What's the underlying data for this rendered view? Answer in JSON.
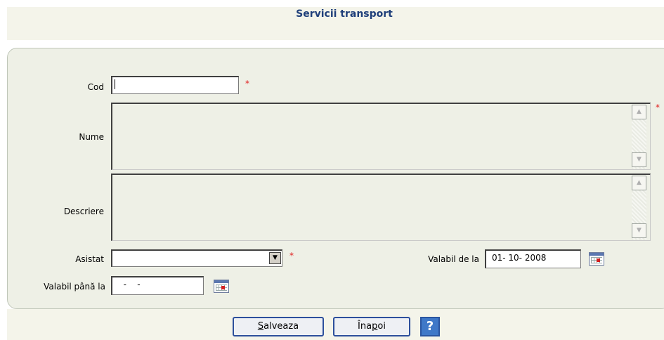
{
  "title": "Servicii transport",
  "form": {
    "cod": {
      "label": "Cod",
      "value": "",
      "required": "*"
    },
    "nume": {
      "label": "Nume",
      "value": "",
      "required": "*"
    },
    "descriere": {
      "label": "Descriere",
      "value": ""
    },
    "asistat": {
      "label": "Asistat",
      "value": "",
      "required": "*"
    },
    "valabil_de_la": {
      "label": "Valabil de la",
      "value": "01- 10-  2008"
    },
    "valabil_pana_la": {
      "label": "Valabil până la",
      "value": "  -    -"
    }
  },
  "buttons": {
    "save": {
      "accel": "S",
      "rest": "alveaza"
    },
    "back": {
      "pre": "Îna",
      "accel": "p",
      "rest": "oi"
    },
    "help": "?"
  },
  "icons": {
    "calendar": "calendar-icon",
    "dropdown": "chevron-down-icon",
    "scroll_up": "scroll-up-icon",
    "scroll_down": "scroll-down-icon",
    "help": "help-icon"
  },
  "colors": {
    "title": "#1f3f7a",
    "required": "#e02020",
    "panel": "#eef0e6",
    "button_border": "#2d4f9c"
  }
}
